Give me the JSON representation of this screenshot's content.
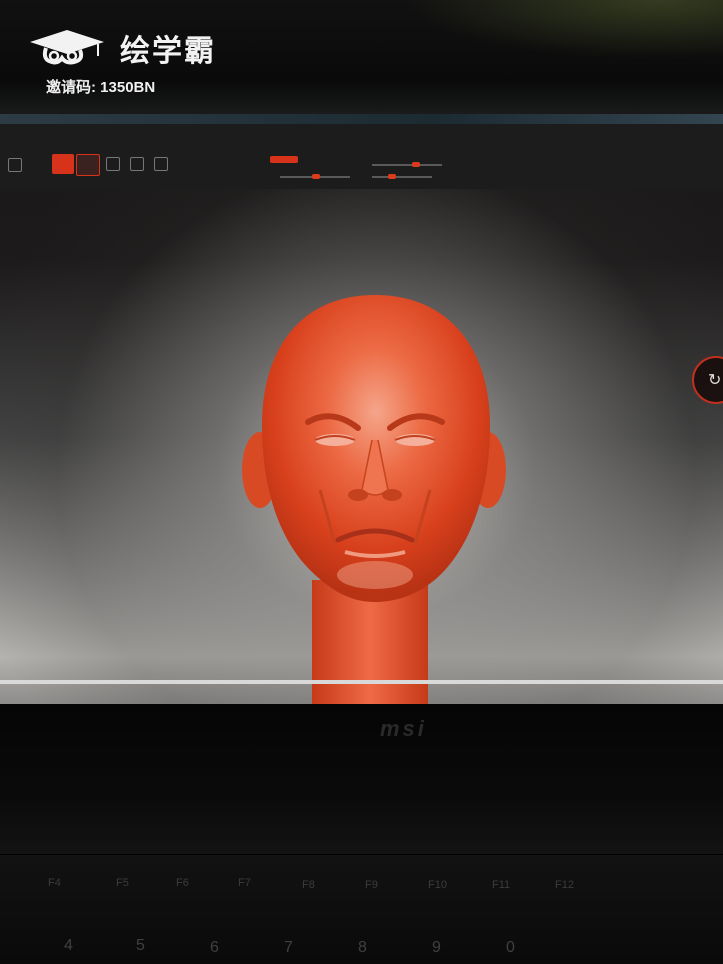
{
  "watermark": {
    "brand_name": "绘学霸",
    "invite_code": "邀请码: 1350BN",
    "logo_icon": "graduation-cap-cloud-icon"
  },
  "laptop": {
    "brand": "msi"
  },
  "keyboard": {
    "function_keys": [
      "F4",
      "F5",
      "F6",
      "F7",
      "F8",
      "F9",
      "F10",
      "F11",
      "F12"
    ],
    "number_keys": [
      "4",
      "5",
      "6",
      "7",
      "8",
      "9",
      "0"
    ]
  },
  "colors": {
    "clay": "#e8401c",
    "accent_red": "#d7321a"
  }
}
